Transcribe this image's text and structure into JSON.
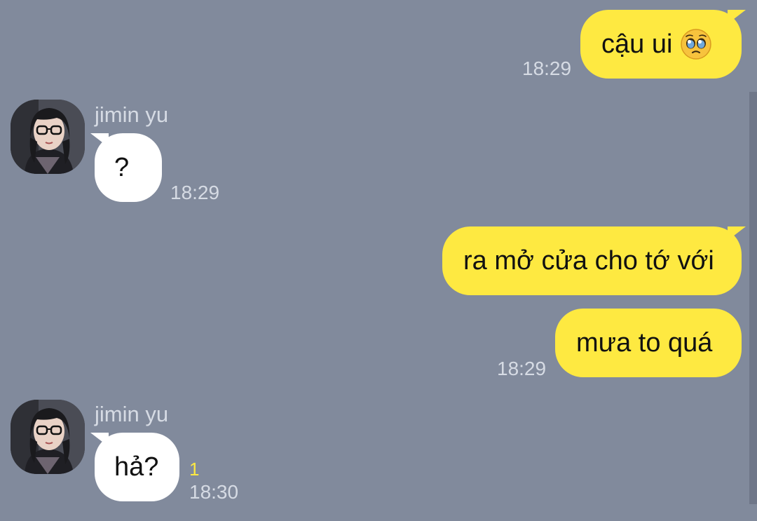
{
  "colors": {
    "background": "#818a9c",
    "outgoing_bubble": "#fee941",
    "incoming_bubble": "#ffffff",
    "meta_text": "#d6dbe4",
    "unread_count": "#fee941"
  },
  "messages": [
    {
      "direction": "outgoing",
      "text": "cậu ui",
      "emoji": "pleading-face-icon",
      "time": "18:29"
    },
    {
      "direction": "incoming",
      "sender": "jimin yu",
      "text": "?",
      "time": "18:29"
    },
    {
      "direction": "outgoing",
      "text": "ra mở cửa cho tớ với"
    },
    {
      "direction": "outgoing",
      "text": "mưa to quá",
      "time": "18:29"
    },
    {
      "direction": "incoming",
      "sender": "jimin yu",
      "text": "hả?",
      "unread": "1",
      "time": "18:30"
    }
  ]
}
